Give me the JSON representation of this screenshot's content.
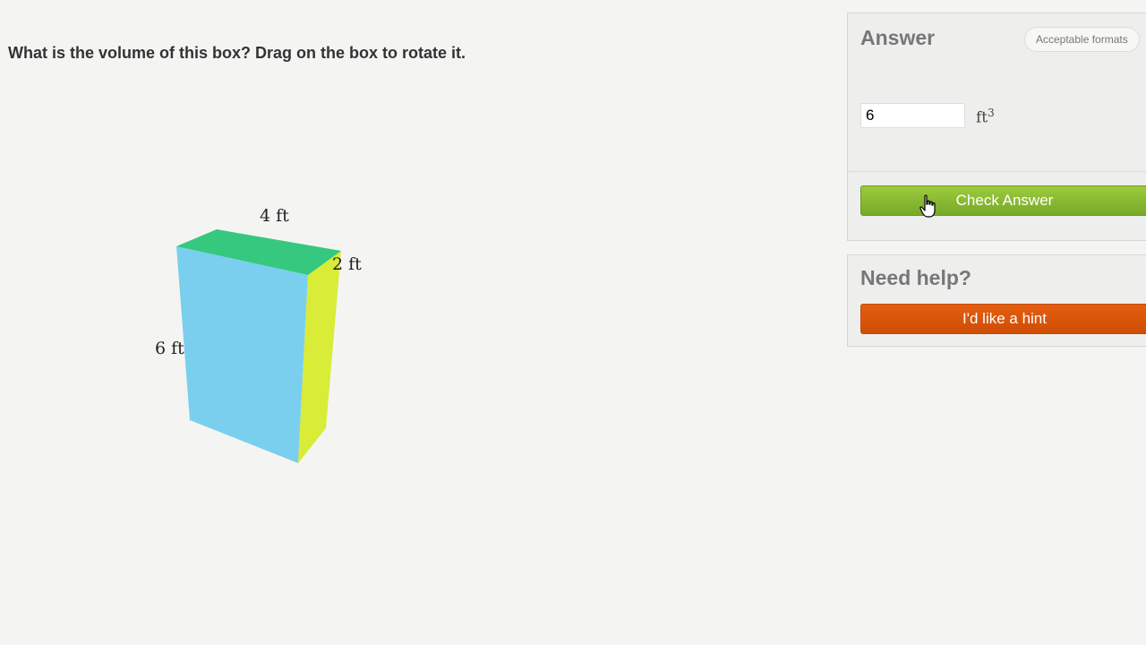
{
  "question": {
    "text": "What is the volume of this box? Drag on the box to rotate it."
  },
  "figure": {
    "labels": {
      "length": "4 ft",
      "width": "2 ft",
      "height": "6 ft"
    },
    "face_colors": {
      "front": "#7bcfee",
      "top": "#36c87f",
      "side": "#d8ec38"
    }
  },
  "answer_panel": {
    "title": "Answer",
    "formats_label": "Acceptable formats",
    "input_value": "6",
    "unit": "ft",
    "unit_exponent": "3",
    "check_label": "Check Answer",
    "check_color": "#8bbd34"
  },
  "help_panel": {
    "title": "Need help?",
    "hint_label": "I'd like a hint",
    "hint_color": "#d9560a"
  },
  "cursor": {
    "icon": "hand-pointer-icon"
  }
}
